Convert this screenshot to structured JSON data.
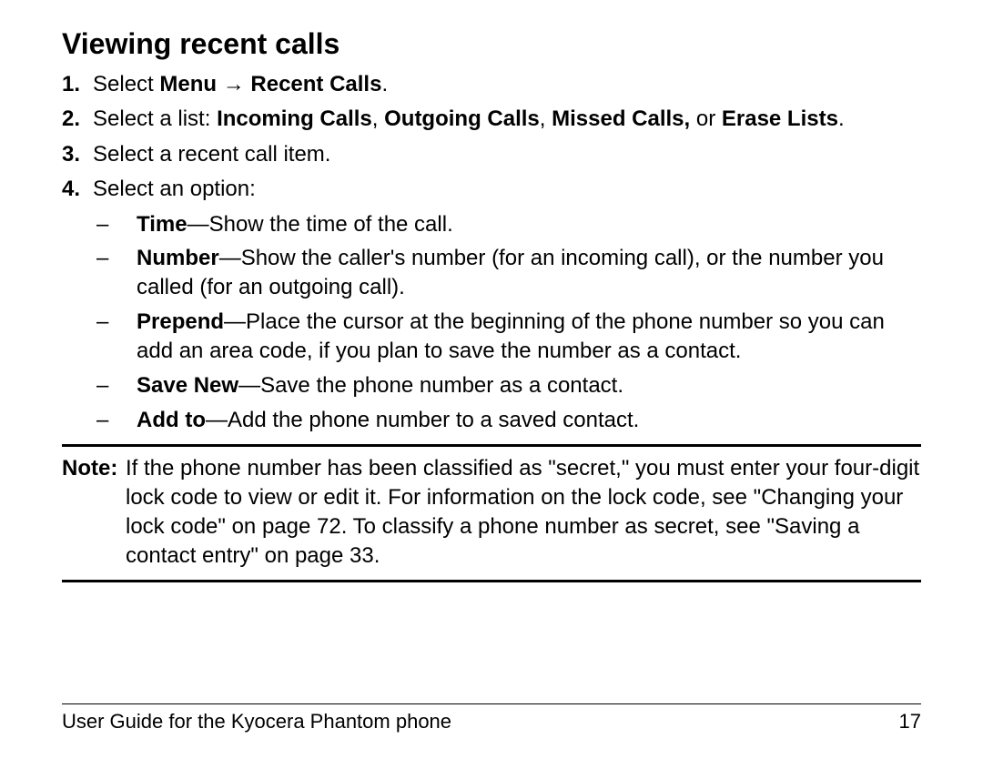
{
  "heading": "Viewing recent calls",
  "steps": [
    {
      "num": "1.",
      "parts": [
        {
          "text": "Select ",
          "bold": false
        },
        {
          "text": "Menu",
          "bold": true
        },
        {
          "text": " → ",
          "bold": false
        },
        {
          "text": "Recent Calls",
          "bold": true
        },
        {
          "text": ".",
          "bold": false
        }
      ]
    },
    {
      "num": "2.",
      "parts": [
        {
          "text": "Select a list: ",
          "bold": false
        },
        {
          "text": "Incoming Calls",
          "bold": true
        },
        {
          "text": ", ",
          "bold": false
        },
        {
          "text": "Outgoing Calls",
          "bold": true
        },
        {
          "text": ", ",
          "bold": false
        },
        {
          "text": "Missed Calls,",
          "bold": true
        },
        {
          "text": " or ",
          "bold": false
        },
        {
          "text": "Erase Lists",
          "bold": true
        },
        {
          "text": ".",
          "bold": false
        }
      ]
    },
    {
      "num": "3.",
      "parts": [
        {
          "text": "Select a recent call item.",
          "bold": false
        }
      ]
    },
    {
      "num": "4.",
      "parts": [
        {
          "text": "Select an option:",
          "bold": false
        }
      ],
      "subitems": [
        {
          "parts": [
            {
              "text": "Time",
              "bold": true
            },
            {
              "text": "—Show the time of the call.",
              "bold": false
            }
          ]
        },
        {
          "parts": [
            {
              "text": "Number",
              "bold": true
            },
            {
              "text": "—Show the caller's number (for an incoming call), or the number you called (for an outgoing call).",
              "bold": false
            }
          ]
        },
        {
          "parts": [
            {
              "text": "Prepend",
              "bold": true
            },
            {
              "text": "—Place the cursor at the beginning of the phone number so you can add an area code, if you plan to save the number as a contact.",
              "bold": false
            }
          ]
        },
        {
          "parts": [
            {
              "text": "Save New",
              "bold": true
            },
            {
              "text": "—Save the phone number as a contact.",
              "bold": false
            }
          ]
        },
        {
          "parts": [
            {
              "text": "Add to",
              "bold": true
            },
            {
              "text": "—Add the phone number to a saved contact.",
              "bold": false
            }
          ]
        }
      ]
    }
  ],
  "note": {
    "label": "Note:",
    "text": "If the phone number has been classified as \"secret,\" you must enter your four-digit lock code to view or edit it. For information on the lock code, see \"Changing your lock code\" on page 72. To classify a phone number as secret, see \"Saving a contact entry\" on page 33."
  },
  "footer": {
    "left": "User Guide for the Kyocera Phantom phone",
    "right": "17"
  }
}
